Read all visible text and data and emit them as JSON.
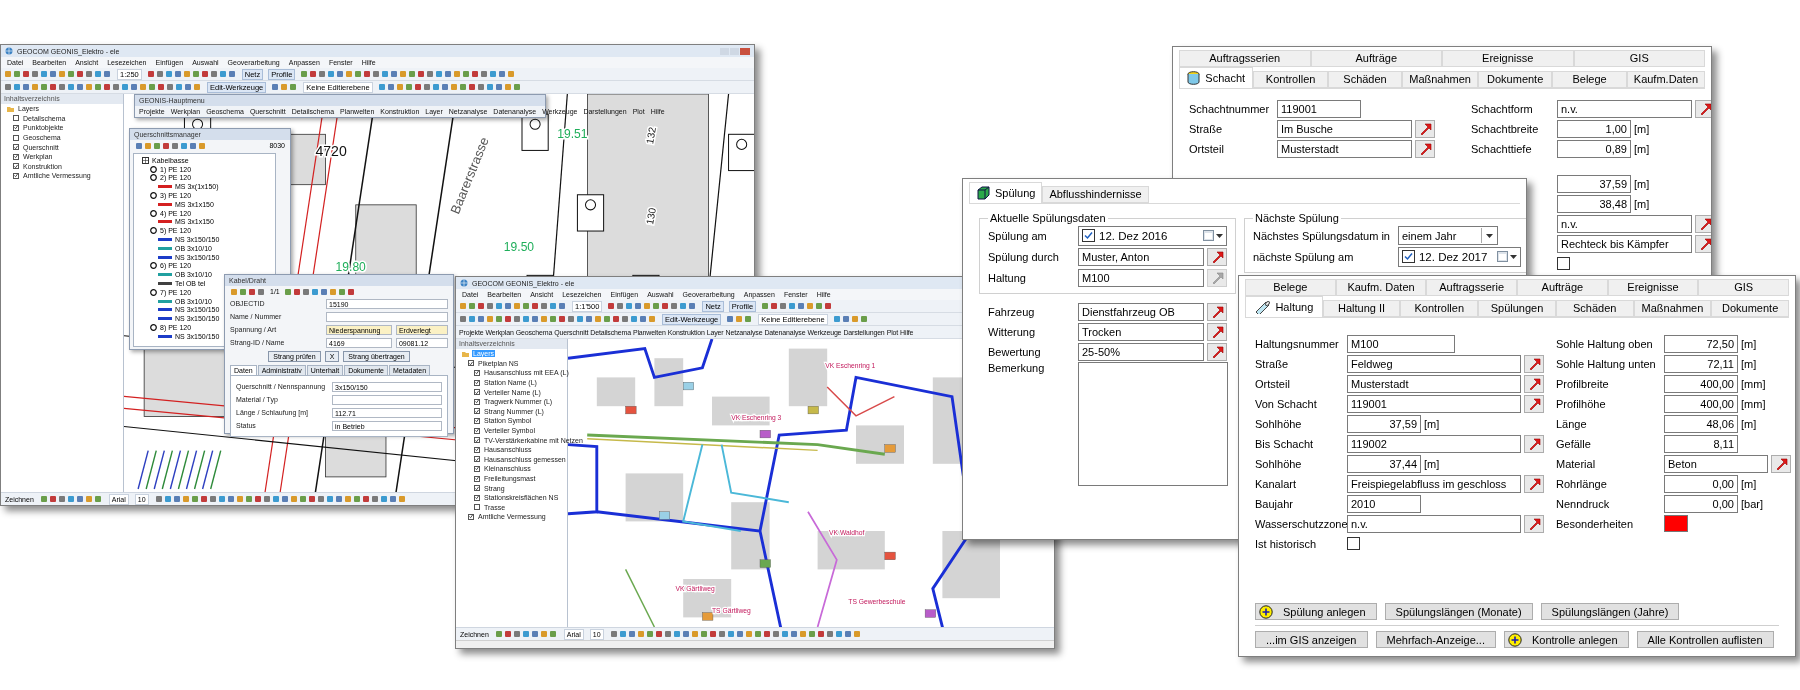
{
  "gis_main": {
    "title": "GEOCOM GEONIS_Elektro - ele",
    "menu": [
      "Datei",
      "Bearbeiten",
      "Ansicht",
      "Lesezeichen",
      "Einfügen",
      "Auswahl",
      "Geoverarbeitung",
      "Anpassen",
      "Fenster",
      "Hilfe"
    ],
    "toolbar": {
      "scale": "1:250",
      "buttons": [
        "Netz",
        "Profile"
      ],
      "edit_tools": "Edit-Werkzeuge",
      "edit_layer": "Keine Editierebene"
    },
    "toc": {
      "title": "Inhaltsverzeichnis",
      "tree": [
        {
          "label": "Layers",
          "selected": false,
          "children": [
            {
              "label": "Detailschema",
              "checked": false
            },
            {
              "label": "Punktobjekte",
              "checked": true
            },
            {
              "label": "Geoschema",
              "checked": false
            },
            {
              "label": "Querschnitt",
              "checked": true
            },
            {
              "label": "Werkplan",
              "checked": true
            },
            {
              "label": "Konstruktion",
              "checked": true
            },
            {
              "label": "Amtliche Vermessung",
              "checked": true
            }
          ]
        }
      ]
    },
    "main_menu": {
      "title": "GEONIS-Hauptmenu",
      "items": [
        "Projekte",
        "Werkplan",
        "Geoschema",
        "Querschnitt",
        "Detailschema",
        "Planwelten",
        "Konstruktion",
        "Layer",
        "Netzanalyse",
        "Datenanalyse",
        "Werkzeuge",
        "Darstellungen",
        "Plot",
        "Hilfe"
      ]
    },
    "map_labels": [
      {
        "text": "4720",
        "kind": "number"
      },
      {
        "text": "Baarerstrasse",
        "kind": "street"
      },
      {
        "text": "19.51",
        "kind": "height"
      },
      {
        "text": "19.50",
        "kind": "height"
      },
      {
        "text": "19.80",
        "kind": "height"
      },
      {
        "text": "132",
        "kind": "rotated"
      },
      {
        "text": "130",
        "kind": "rotated"
      }
    ],
    "cross_section": {
      "title": "Querschnittsmanager",
      "code": "8030",
      "tree": [
        {
          "label": "Kabelbasse",
          "children": [
            {
              "label": "1) PE 120"
            },
            {
              "label": "2) PE 120",
              "children": [
                {
                  "label": "MS 3x(1x150)",
                  "color": "#d42020"
                }
              ]
            },
            {
              "label": "3) PE 120",
              "children": [
                {
                  "label": "MS 3x1x150",
                  "color": "#d42020"
                }
              ]
            },
            {
              "label": "4) PE 120",
              "children": [
                {
                  "label": "MS 3x1x150",
                  "color": "#d42020"
                }
              ]
            },
            {
              "label": "5) PE 120",
              "children": [
                {
                  "label": "NS 3x150/150",
                  "color": "#1c3cc8"
                },
                {
                  "label": "OB 3x10/10",
                  "color": "#20a0a0"
                },
                {
                  "label": "NS 3x150/150",
                  "color": "#1c3cc8"
                }
              ]
            },
            {
              "label": "6) PE 120",
              "children": [
                {
                  "label": "OB 3x10/10",
                  "color": "#20a0a0"
                },
                {
                  "label": "Tel OB tel",
                  "color": "#404040"
                }
              ]
            },
            {
              "label": "7) PE 120",
              "children": [
                {
                  "label": "OB 3x10/10",
                  "color": "#20a0a0"
                },
                {
                  "label": "NS 3x150/150",
                  "color": "#1c3cc8"
                },
                {
                  "label": "NS 3x150/150",
                  "color": "#1c3cc8"
                }
              ]
            },
            {
              "label": "8) PE 120",
              "children": [
                {
                  "label": "NS 3x150/150",
                  "color": "#1c3cc8"
                }
              ]
            }
          ]
        }
      ]
    },
    "cable_dialog": {
      "title": "Kabel/Draht",
      "pager": "1/1",
      "rows": [
        {
          "label": "OBJECTID",
          "values": [
            "15190"
          ]
        },
        {
          "label": "Name / Nummer"
        },
        {
          "label": "Spannung / Art",
          "values": [
            "Niederspannung",
            "Erdverlegt"
          ]
        },
        {
          "label": "Strang-ID / Name",
          "values": [
            "4169",
            "09081.12"
          ]
        }
      ],
      "buttons": [
        "Strang prüfen",
        "X",
        "Strang übertragen"
      ],
      "tabs": [
        {
          "label": "Daten",
          "selected": true
        },
        {
          "label": "Administrativ",
          "selected": false
        },
        {
          "label": "Unterhalt",
          "selected": false
        },
        {
          "label": "Dokumente",
          "selected": false
        },
        {
          "label": "Metadaten",
          "selected": false
        }
      ],
      "fields": [
        {
          "label": "Querschnitt / Nennspannung",
          "value": "3x150/150"
        },
        {
          "label": "Material / Typ"
        },
        {
          "label": "Länge / Schlaufung [m]",
          "value": "112.71"
        },
        {
          "label": "Status",
          "value": "in Betrieb"
        }
      ]
    },
    "draw_toolbar": {
      "draw": "Zeichnen",
      "font": "Arial",
      "size": "10"
    }
  },
  "gis_detail": {
    "title": "GEOCOM GEONIS_Elektro - ele",
    "menu": [
      "Datei",
      "Bearbeiten",
      "Ansicht",
      "Lesezeichen",
      "Einfügen",
      "Auswahl",
      "Geoverarbeitung",
      "Anpassen",
      "Fenster",
      "Hilfe"
    ],
    "toolbar": {
      "scale": "1:1'500",
      "buttons": [
        "Netz",
        "Profile"
      ],
      "edit_tools": "Edit-Werkzeuge",
      "edit_layer": "Keine Editierebene"
    },
    "main_menu": {
      "items": [
        "Projekte",
        "Werkplan",
        "Geoschema",
        "Querschnitt",
        "Detailschema",
        "Planwelten",
        "Konstruktion",
        "Layer",
        "Netzanalyse",
        "Datenanalyse",
        "Werkzeuge",
        "Darstellungen",
        "Plot",
        "Hilfe"
      ]
    },
    "toc": {
      "title": "Inhaltsverzeichnis",
      "tree": [
        {
          "label": "Layers",
          "selected": true,
          "children": [
            {
              "label": "Piketplan NS",
              "checked": true,
              "children": [
                {
                  "label": "Hausanschluss mit EEA (L)",
                  "checked": true
                },
                {
                  "label": "Station Name (L)",
                  "checked": true
                },
                {
                  "label": "Verteiler Name (L)",
                  "checked": true
                },
                {
                  "label": "Tragwerk Nummer (L)",
                  "checked": true
                },
                {
                  "label": "Strang Nummer (L)",
                  "checked": true
                },
                {
                  "label": "Station Symbol",
                  "checked": true
                },
                {
                  "label": "Verteiler Symbol",
                  "checked": true
                },
                {
                  "label": "TV-Verstärkerkabine mit Netzen",
                  "checked": true
                },
                {
                  "label": "Hausanschluss",
                  "checked": true
                },
                {
                  "label": "Hausanschluss gemessen",
                  "checked": true
                },
                {
                  "label": "Kleinanschluss",
                  "checked": true
                },
                {
                  "label": "Freileitungsmast",
                  "checked": true
                },
                {
                  "label": "Strang",
                  "checked": true
                },
                {
                  "label": "Stationskreisflächen NS",
                  "checked": true
                },
                {
                  "label": "Trasse",
                  "checked": false
                }
              ]
            },
            {
              "label": "Amtliche Vermessung",
              "checked": true
            }
          ]
        }
      ]
    },
    "map_labels": [
      "VK Eschenring 1",
      "VK Eschenring 3",
      "VK Waldhof",
      "TS Gewerbeschule",
      "VK Gärtliweg",
      "TS Gärtliweg"
    ],
    "draw_toolbar": {
      "draw": "Zeichnen",
      "font": "Arial",
      "size": "10"
    }
  },
  "schacht": {
    "tab_rows": [
      [
        {
          "label": "Auftragsserien",
          "selected": false
        },
        {
          "label": "Aufträge",
          "selected": false
        },
        {
          "label": "Ereignisse",
          "selected": false
        },
        {
          "label": "GIS",
          "selected": false
        }
      ],
      [
        {
          "label": "Schacht",
          "selected": true
        },
        {
          "label": "Kontrollen",
          "selected": false
        },
        {
          "label": "Schäden",
          "selected": false
        },
        {
          "label": "Maßnahmen",
          "selected": false
        },
        {
          "label": "Dokumente",
          "selected": false
        },
        {
          "label": "Belege",
          "selected": false
        },
        {
          "label": "Kaufm.Daten",
          "selected": false
        }
      ]
    ],
    "fields_left": [
      {
        "label": "Schachtnummer",
        "kind": "short",
        "value": "119001"
      },
      {
        "label": "Straße",
        "kind": "picker",
        "value": "Im Busche"
      },
      {
        "label": "Ortsteil",
        "kind": "picker",
        "value": "Musterstadt"
      }
    ],
    "fields_right": [
      {
        "label": "Schachtform",
        "kind": "picker",
        "value": "n.v."
      },
      {
        "label": "Schachtbreite",
        "kind": "number",
        "value": "1,00",
        "unit": "[m]"
      },
      {
        "label": "Schachttiefe",
        "kind": "number",
        "value": "0,89",
        "unit": "[m]"
      }
    ],
    "fields_right_lower": [
      {
        "kind": "number",
        "value": "37,59",
        "unit": "[m]"
      },
      {
        "kind": "number",
        "value": "38,48",
        "unit": "[m]"
      },
      {
        "kind": "picker",
        "value": "n.v."
      },
      {
        "kind": "picker",
        "value": "Rechteck bis Kämpfer"
      },
      {
        "kind": "checkbox",
        "checked": false
      }
    ]
  },
  "spuelung": {
    "tabs": [
      {
        "label": "Spülung",
        "selected": true
      },
      {
        "label": "Abflusshindernisse",
        "selected": false
      }
    ],
    "current": {
      "title": "Aktuelle Spülungsdaten",
      "fields": [
        {
          "label": "Spülung am",
          "kind": "date",
          "checked": true,
          "value": "12. Dez 2016"
        },
        {
          "label": "Spülung durch",
          "kind": "picker",
          "value": "Muster, Anton",
          "disabled": false
        },
        {
          "label": "Haltung",
          "kind": "picker",
          "value": "M100",
          "disabled": true
        }
      ]
    },
    "next": {
      "title": "Nächste Spülung",
      "fields": [
        {
          "label": "Nächstes Spülungsdatum in",
          "kind": "combo",
          "value": "einem Jahr"
        },
        {
          "label": "nächste Spülung am",
          "kind": "date",
          "checked": true,
          "value": "12. Dez 2017"
        }
      ]
    },
    "fields": [
      {
        "label": "Fahrzeug",
        "kind": "picker",
        "value": "Dienstfahrzeug OB"
      },
      {
        "label": "Witterung",
        "kind": "picker",
        "value": "Trocken"
      },
      {
        "label": "Bewertung",
        "kind": "picker",
        "value": "25-50%"
      },
      {
        "label": "Bemerkung",
        "kind": "memo"
      }
    ]
  },
  "haltung": {
    "tab_rows": [
      [
        {
          "label": "Belege",
          "selected": false
        },
        {
          "label": "Kaufm. Daten",
          "selected": false
        },
        {
          "label": "Auftragsserie",
          "selected": false
        },
        {
          "label": "Aufträge",
          "selected": false
        },
        {
          "label": "Ereignisse",
          "selected": false
        },
        {
          "label": "GIS",
          "selected": false
        }
      ],
      [
        {
          "label": "Haltung",
          "selected": true
        },
        {
          "label": "Haltung II",
          "selected": false
        },
        {
          "label": "Kontrollen",
          "selected": false
        },
        {
          "label": "Spülungen",
          "selected": false
        },
        {
          "label": "Schäden",
          "selected": false
        },
        {
          "label": "Maßnahmen",
          "selected": false
        },
        {
          "label": "Dokumente",
          "selected": false
        }
      ]
    ],
    "fields_left": [
      {
        "label": "Haltungsnummer",
        "kind": "short",
        "value": "M100"
      },
      {
        "label": "Straße",
        "kind": "picker",
        "value": "Feldweg"
      },
      {
        "label": "Ortsteil",
        "kind": "picker",
        "value": "Musterstadt"
      },
      {
        "label": "Von Schacht",
        "kind": "picker",
        "value": "119001"
      },
      {
        "label": "Sohlhöhe",
        "kind": "number",
        "value": "37,59",
        "unit": "[m]"
      },
      {
        "label": "Bis Schacht",
        "kind": "picker",
        "value": "119002"
      },
      {
        "label": "Sohlhöhe",
        "kind": "number",
        "value": "37,44",
        "unit": "[m]"
      },
      {
        "label": "Kanalart",
        "kind": "picker",
        "value": "Freispiegelabfluss im geschloss"
      },
      {
        "label": "Baujahr",
        "kind": "number_short",
        "value": "2010"
      },
      {
        "label": "Wasserschutzzone",
        "kind": "picker",
        "value": "n.v."
      },
      {
        "label": "Ist historisch",
        "kind": "checkbox",
        "checked": false
      }
    ],
    "fields_right": [
      {
        "label": "Sohle Haltung oben",
        "kind": "number",
        "value": "72,50",
        "unit": "[m]"
      },
      {
        "label": "Sohle Haltung unten",
        "kind": "number",
        "value": "72,11",
        "unit": "[m]"
      },
      {
        "label": "Profilbreite",
        "kind": "number",
        "value": "400,00",
        "unit": "[mm]"
      },
      {
        "label": "Profilhöhe",
        "kind": "number",
        "value": "400,00",
        "unit": "[mm]"
      },
      {
        "label": "Länge",
        "kind": "number",
        "value": "48,06",
        "unit": "[m]"
      },
      {
        "label": "Gefälle",
        "kind": "number",
        "value": "8,11"
      },
      {
        "label": "Material",
        "kind": "picker_short",
        "value": "Beton"
      },
      {
        "label": "Rohrlänge",
        "kind": "number",
        "value": "0,00",
        "unit": "[m]"
      },
      {
        "label": "Nenndruck",
        "kind": "number",
        "value": "0,00",
        "unit": "[bar]"
      },
      {
        "label": "Besonderheiten",
        "kind": "color",
        "color": "#ff0000"
      }
    ],
    "button_rows": [
      [
        {
          "label": "Spülung anlegen",
          "kind": "add"
        },
        {
          "label": "Spülungslängen (Monate)",
          "kind": "plain"
        },
        {
          "label": "Spülungslängen (Jahre)",
          "kind": "plain"
        }
      ],
      [
        {
          "label": "...im GIS anzeigen",
          "kind": "plain"
        },
        {
          "label": "Mehrfach-Anzeige...",
          "kind": "plain"
        },
        {
          "label": "Kontrolle anlegen",
          "kind": "add"
        },
        {
          "label": "Alle Kontrollen auflisten",
          "kind": "plain"
        }
      ]
    ]
  }
}
